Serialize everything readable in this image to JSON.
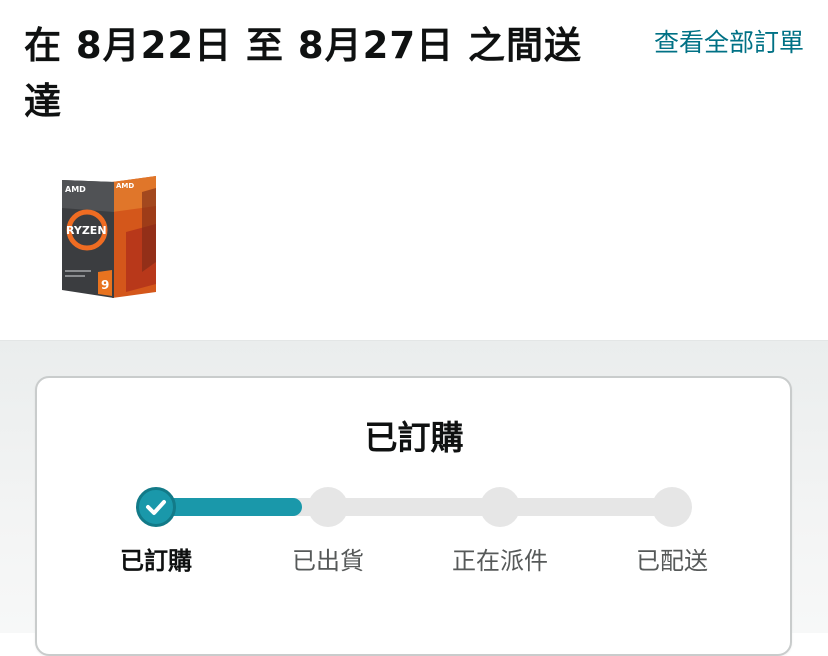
{
  "header": {
    "delivery_text": "在 8月22日 至 8月27日 之間送達",
    "view_all_orders": "查看全部訂單"
  },
  "product": {
    "image_brand": "AMD",
    "image_line": "RYZEN",
    "image_tier": "9"
  },
  "tracking": {
    "status_title": "已訂購",
    "progress_fraction": 0.17,
    "steps": [
      {
        "label": "已訂購",
        "completed": true
      },
      {
        "label": "已出貨",
        "completed": false
      },
      {
        "label": "正在派件",
        "completed": false
      },
      {
        "label": "已配送",
        "completed": false
      }
    ]
  },
  "colors": {
    "accent": "#1a98aa",
    "link": "#007185",
    "text": "#0f1111",
    "muted": "#565959"
  }
}
